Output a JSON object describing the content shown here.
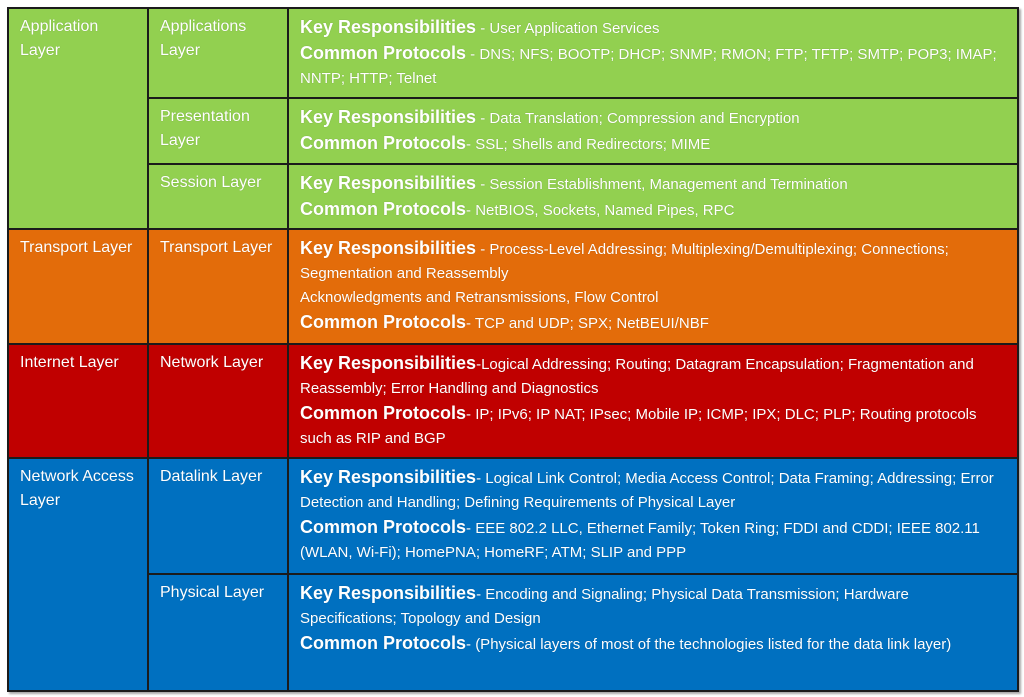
{
  "colors": {
    "application": "#92d050",
    "transport": "#e36c0a",
    "internet": "#c00000",
    "network_access": "#0070c0",
    "border": "#1b1b1b",
    "text": "#ffffff"
  },
  "labels": {
    "key": "Key Responsibilities",
    "common": "Common Protocols"
  },
  "tcpip_layers": [
    {
      "name": "Application Layer"
    },
    {
      "name": "Transport Layer"
    },
    {
      "name": "Internet Layer"
    },
    {
      "name": "Network Access Layer"
    }
  ],
  "osi_layers": [
    {
      "name": "Applications Layer",
      "key_sep": " - ",
      "key_text": "User Application Services",
      "common_sep": " - ",
      "common_text": "DNS; NFS; BOOTP; DHCP; SNMP; RMON; FTP; TFTP; SMTP; POP3; IMAP; NNTP; HTTP; Telnet"
    },
    {
      "name": "Presentation Layer",
      "key_sep": " - ",
      "key_text": "Data Translation; Compression and Encryption",
      "common_sep": "- ",
      "common_text": "SSL; Shells and Redirectors; MIME"
    },
    {
      "name": "Session Layer",
      "key_sep": " - ",
      "key_text": "Session Establishment, Management and Termination",
      "common_sep": "- ",
      "common_text": "NetBIOS, Sockets, Named Pipes, RPC"
    },
    {
      "name": "Transport Layer",
      "key_sep": " - ",
      "key_text": "Process-Level Addressing; Multiplexing/Demultiplexing; Connections; Segmentation and Reassembly",
      "key_text_2": "Acknowledgments and Retransmissions, Flow Control",
      "common_sep": "- ",
      "common_text": "TCP and UDP; SPX; NetBEUI/NBF"
    },
    {
      "name": "Network Layer",
      "key_sep": "-",
      "key_text": "Logical Addressing; Routing; Datagram Encapsulation; Fragmentation and Reassembly; Error Handling and Diagnostics",
      "common_sep": "- ",
      "common_text": " IP; IPv6; IP NAT; IPsec; Mobile IP; ICMP; IPX; DLC; PLP; Routing protocols such as RIP and BGP"
    },
    {
      "name": "Datalink Layer",
      "key_sep": "- ",
      "key_text": "Logical Link Control; Media Access Control; Data Framing; Addressing; Error Detection and Handling; Defining Requirements of Physical Layer",
      "common_sep": "- ",
      "common_text": "EEE 802.2 LLC, Ethernet Family; Token Ring; FDDI and CDDI; IEEE 802.11 (WLAN, Wi-Fi); HomePNA; HomeRF; ATM; SLIP and PPP"
    },
    {
      "name": "Physical Layer",
      "key_sep": "- ",
      "key_text": "Encoding and Signaling; Physical Data Transmission; Hardware Specifications; Topology and Design",
      "common_sep": "- ",
      "common_text": "(Physical layers of most of the technologies listed for the data link layer)"
    }
  ]
}
